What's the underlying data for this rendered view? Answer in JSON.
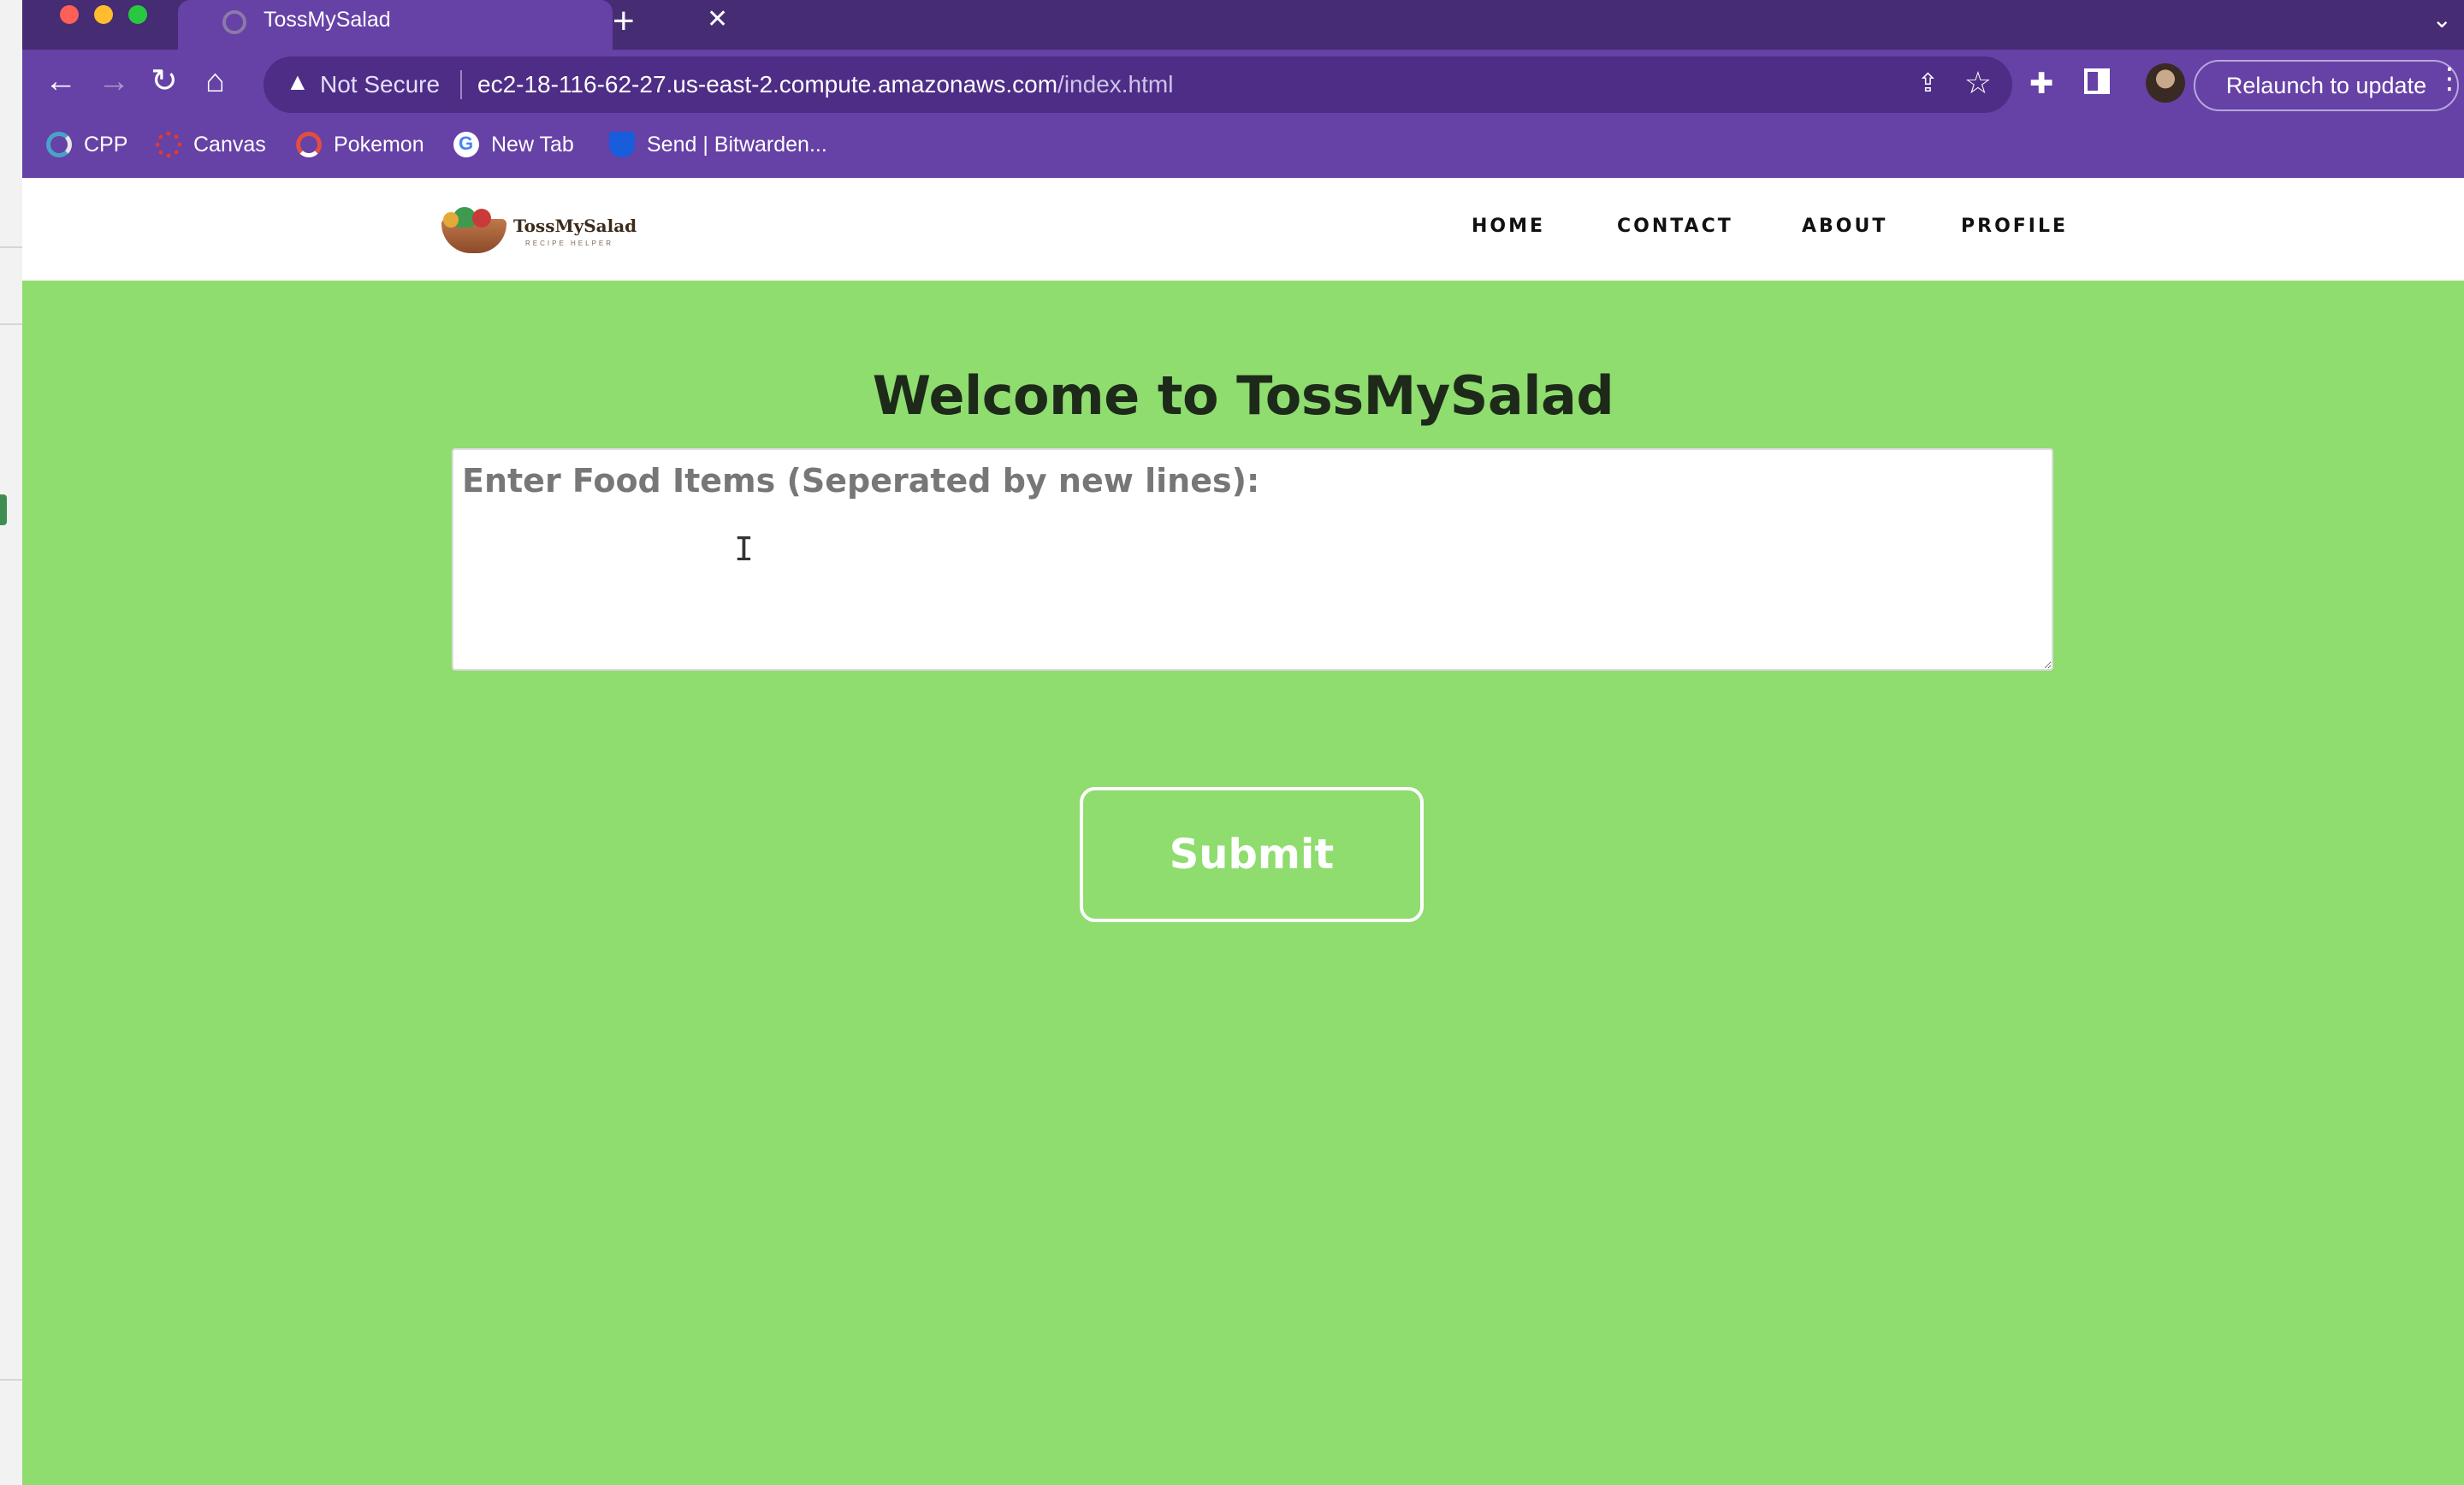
{
  "browser": {
    "tab": {
      "title": "TossMySalad",
      "close_icon": "close-icon"
    },
    "toolbar": {
      "security_label": "Not Secure",
      "url_host": "ec2-18-116-62-27.us-east-2.compute.amazonaws.com",
      "url_path": "/index.html",
      "relaunch_label": "Relaunch to update"
    },
    "bookmarks": [
      {
        "label": "CPP"
      },
      {
        "label": "Canvas"
      },
      {
        "label": "Pokemon"
      },
      {
        "label": "New Tab"
      },
      {
        "label": "Send | Bitwarden..."
      }
    ]
  },
  "site": {
    "logo": {
      "name": "TossMySalad",
      "tagline": "RECIPE HELPER"
    },
    "nav": [
      {
        "label": "HOME"
      },
      {
        "label": "CONTACT"
      },
      {
        "label": "ABOUT"
      },
      {
        "label": "PROFILE"
      }
    ],
    "heading": "Welcome to TossMySalad",
    "food_input": {
      "value": "",
      "placeholder": "Enter Food Items (Seperated by new lines):"
    },
    "submit_label": "Submit"
  },
  "colors": {
    "tabstrip": "#452c73",
    "toolbar": "#6641a6",
    "page_background": "#8fdc6f",
    "heading_text": "#1d2a1a"
  }
}
